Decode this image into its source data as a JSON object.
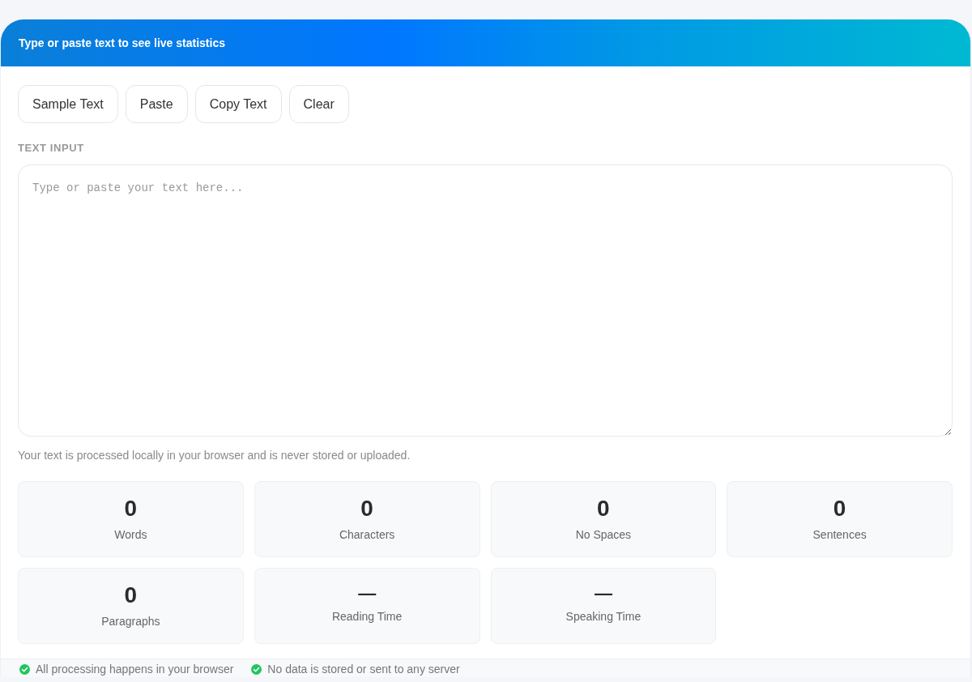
{
  "header": {
    "subtitle": "Type or paste text to see live statistics"
  },
  "toolbar": {
    "buttons": [
      "Sample Text",
      "Paste",
      "Copy Text",
      "Clear"
    ]
  },
  "text_input": {
    "label": "TEXT INPUT",
    "placeholder": "Type or paste your text here...",
    "note": "Your text is processed locally in your browser and is never stored or uploaded."
  },
  "stats": [
    {
      "kind": "count",
      "value": "0",
      "label": "Words"
    },
    {
      "kind": "count",
      "value": "0",
      "label": "Characters"
    },
    {
      "kind": "count",
      "value": "0",
      "label": "No Spaces"
    },
    {
      "kind": "count",
      "value": "0",
      "label": "Sentences"
    },
    {
      "kind": "count",
      "value": "0",
      "label": "Paragraphs"
    },
    {
      "kind": "time",
      "value": "—",
      "label": "Reading Time"
    },
    {
      "kind": "time",
      "value": "—",
      "label": "Speaking Time"
    }
  ],
  "footer": {
    "items": [
      "All processing happens in your browser",
      "No data is stored or sent to any server"
    ]
  }
}
